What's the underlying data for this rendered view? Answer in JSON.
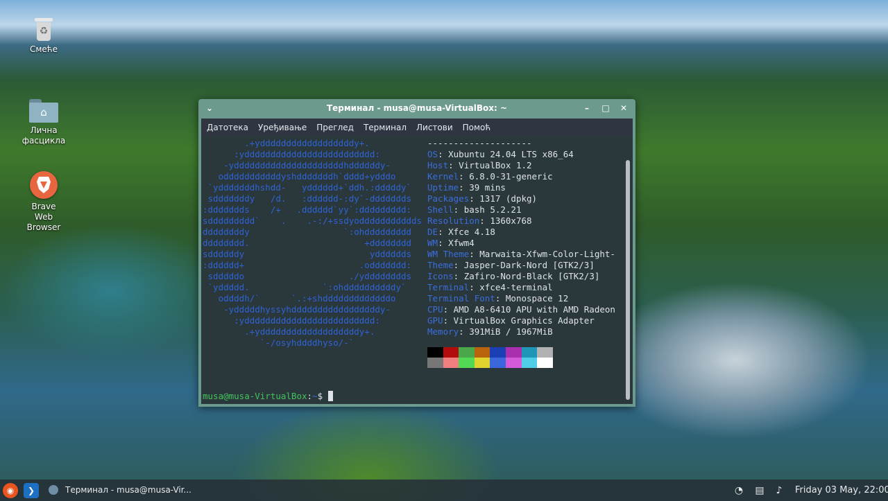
{
  "desktop": {
    "icons": [
      {
        "label": "Смеће"
      },
      {
        "label": "Лична фасцикла"
      },
      {
        "label": "Brave Web Browser"
      }
    ]
  },
  "window": {
    "title": "Терминал - musa@musa-VirtualBox: ~",
    "controls": {
      "menu": "⌄",
      "minimize": "–",
      "maximize": "□",
      "close": "✕"
    },
    "menu": [
      "Датотека",
      "Уређивање",
      "Преглед",
      "Терминал",
      "Листови",
      "Помоћ"
    ]
  },
  "terminal": {
    "logo": [
      "        .+yddddddddddddddddddy+.",
      "      :yddddddddddddddddddddddddd:",
      "    -ydddddddddddddddddddddhddddddy-",
      "   odddddddddddyshdddddddh`dddd+ydddo",
      " `ydddddddhshdd-   ydddddd+`ddh.:dddddy`",
      " sdddddddy   /d.   :dddddd-:dy`-ddddddds",
      ":ddddddds    /+   .dddddd`yy`:ddddddddd:",
      "sddddddddd`    .    .-:/+ssdyoddddddddddds",
      "ddddddddy                  `:ohddddddddd",
      "dddddddd.                      +dddddddd",
      "sddddddy                        ydddddds",
      ":dddddd+                      .oddddddd:",
      " sdddddo                    ./ydddddddds",
      " `yddddd.              `:ohddddddddddy`",
      "   oddddh/`      `.:+shdddddddddddddo",
      "    -ydddddhyssyhdddddddddddddddddy-",
      "      :yddddddddddddddddddddddddd:",
      "        .+ydddddddddddddddddddy+.",
      "           `-/osyhddddhyso/-`"
    ],
    "info": [
      {
        "key": "",
        "value": "--------------------"
      },
      {
        "key": "OS",
        "value": "Xubuntu 24.04 LTS x86_64"
      },
      {
        "key": "Host",
        "value": "VirtualBox 1.2"
      },
      {
        "key": "Kernel",
        "value": "6.8.0-31-generic"
      },
      {
        "key": "Uptime",
        "value": "39 mins"
      },
      {
        "key": "Packages",
        "value": "1317 (dpkg)"
      },
      {
        "key": "Shell",
        "value": "bash 5.2.21"
      },
      {
        "key": "Resolution",
        "value": "1360x768"
      },
      {
        "key": "DE",
        "value": "Xfce 4.18"
      },
      {
        "key": "WM",
        "value": "Xfwm4"
      },
      {
        "key": "WM Theme",
        "value": "Marwaita-Xfwm-Color-Light-"
      },
      {
        "key": "Theme",
        "value": "Jasper-Dark-Nord [GTK2/3]"
      },
      {
        "key": "Icons",
        "value": "Zafiro-Nord-Black [GTK2/3]"
      },
      {
        "key": "Terminal",
        "value": "xfce4-terminal"
      },
      {
        "key": "Terminal Font",
        "value": "Monospace 12"
      },
      {
        "key": "CPU",
        "value": "AMD A8-6410 APU with AMD Radeon"
      },
      {
        "key": "GPU",
        "value": "VirtualBox Graphics Adapter"
      },
      {
        "key": "Memory",
        "value": "391MiB / 1967MiB"
      }
    ],
    "palette": [
      [
        "#000000",
        "#b20c0c",
        "#4aa84a",
        "#b8640c",
        "#1b3fb5",
        "#a92fae",
        "#1f95b8",
        "#b2b2b2"
      ],
      [
        "#777777",
        "#f07e7e",
        "#52d852",
        "#e0d22f",
        "#3b66dc",
        "#d45ad9",
        "#4fcde6",
        "#ffffff"
      ]
    ],
    "prompt": {
      "user_host": "musa@musa-VirtualBox",
      "sep": ":",
      "path": "~",
      "symbol": "$"
    }
  },
  "taskbar": {
    "window_button": "Терминал - musa@musa-Vir...",
    "clock": "Friday 03 May, 22:00"
  }
}
